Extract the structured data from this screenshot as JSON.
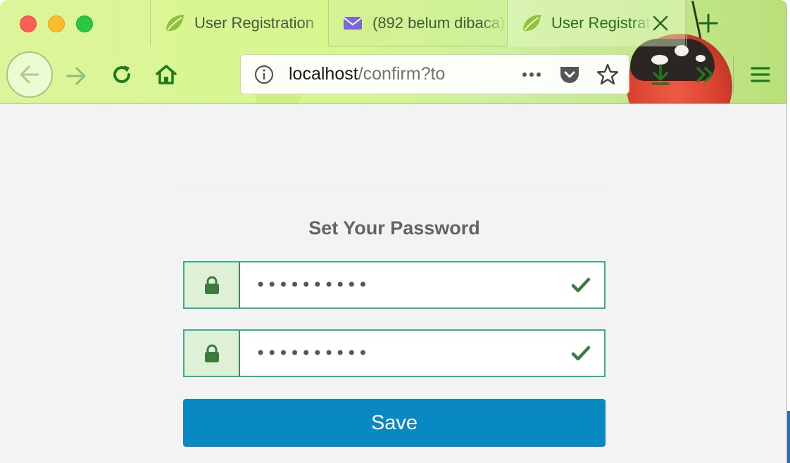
{
  "tabs": [
    {
      "title": "User Registration",
      "favicon": "spring-leaf-icon",
      "active": false
    },
    {
      "title": "(892 belum dibaca)",
      "favicon": "mail-icon",
      "active": false
    },
    {
      "title": "User Registration",
      "favicon": "spring-leaf-icon",
      "active": true
    }
  ],
  "urlbar": {
    "host": "localhost",
    "path": "/confirm?to"
  },
  "form": {
    "title": "Set Your Password",
    "password_value": "••••••••••",
    "confirm_password_value": "••••••••••",
    "save_label": "Save"
  },
  "colors": {
    "accent_button": "#0989c2",
    "valid_border": "#3aae8a",
    "addon_bg": "#def0d8",
    "check": "#3c7a3e"
  },
  "icons": [
    "back-arrow-icon",
    "forward-arrow-icon",
    "reload-icon",
    "home-icon",
    "info-icon",
    "page-actions-icon",
    "pocket-icon",
    "star-icon",
    "download-icon",
    "overflow-chevron-icon",
    "hamburger-menu-icon",
    "lock-icon",
    "checkmark-icon",
    "close-icon",
    "plus-icon"
  ]
}
